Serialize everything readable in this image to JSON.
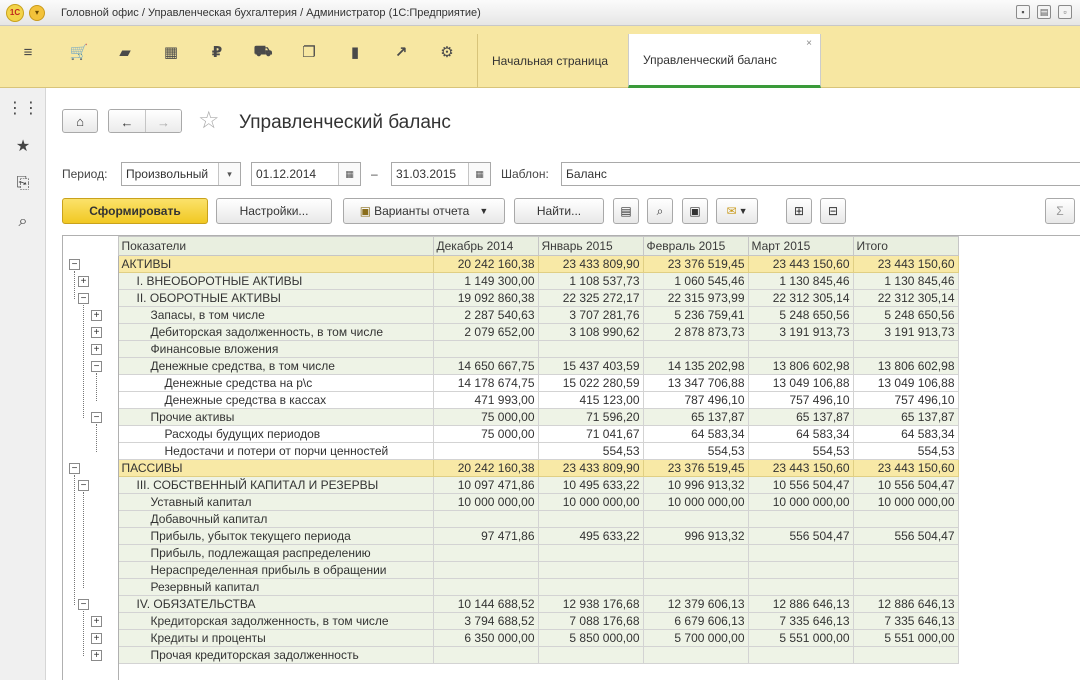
{
  "window": {
    "title": "Головной офис / Управленческая бухгалтерия / Администратор  (1С:Предприятие)",
    "logo_text": "1С"
  },
  "tabs": [
    {
      "label": "Начальная страница",
      "active": false
    },
    {
      "label": "Управленческий баланс",
      "active": true,
      "close": "×"
    }
  ],
  "section_icons": [
    "menu-icon",
    "cart-icon",
    "bag-icon",
    "grid-icon",
    "ruble-icon",
    "truck-icon",
    "documents-icon",
    "bar-chart-icon",
    "trend-icon",
    "gear-icon"
  ],
  "left_icons": [
    "apps-icon",
    "star-icon",
    "history-icon",
    "search-icon"
  ],
  "page": {
    "title": "Управленческий баланс"
  },
  "filters": {
    "period_label": "Период:",
    "period_type": "Произвольный",
    "date_from": "01.12.2014",
    "dash": "–",
    "date_to": "31.03.2015",
    "template_label": "Шаблон:",
    "template_value": "Баланс"
  },
  "commands": {
    "generate": "Сформировать",
    "settings": "Настройки...",
    "variants": "Варианты отчета",
    "find": "Найти...",
    "sum": "Σ"
  },
  "table": {
    "columns": [
      "Показатели",
      "Декабрь 2014",
      "Январь 2015",
      "Февраль 2015",
      "Март 2015",
      "Итого"
    ],
    "rows": [
      {
        "level": 0,
        "toggle": "−",
        "label": "АКТИВЫ",
        "values": [
          "20 242 160,38",
          "23 433 809,90",
          "23 376 519,45",
          "23 443 150,60",
          "23 443 150,60"
        ]
      },
      {
        "level": 1,
        "toggle": "+",
        "label": "I. ВНЕОБОРОТНЫЕ АКТИВЫ",
        "values": [
          "1 149 300,00",
          "1 108 537,73",
          "1 060 545,46",
          "1 130 845,46",
          "1 130 845,46"
        ]
      },
      {
        "level": 1,
        "toggle": "−",
        "label": "II. ОБОРОТНЫЕ АКТИВЫ",
        "values": [
          "19 092 860,38",
          "22 325 272,17",
          "22 315 973,99",
          "22 312 305,14",
          "22 312 305,14"
        ]
      },
      {
        "level": 2,
        "toggle": "+",
        "label": "Запасы, в том числе",
        "values": [
          "2 287 540,63",
          "3 707 281,76",
          "5 236 759,41",
          "5 248 650,56",
          "5 248 650,56"
        ]
      },
      {
        "level": 2,
        "toggle": "+",
        "label": "Дебиторская задолженность, в том числе",
        "values": [
          "2 079 652,00",
          "3 108 990,62",
          "2 878 873,73",
          "3 191 913,73",
          "3 191 913,73"
        ]
      },
      {
        "level": 2,
        "toggle": "+",
        "label": "Финансовые вложения",
        "values": [
          "",
          "",
          "",
          "",
          ""
        ]
      },
      {
        "level": 2,
        "toggle": "−",
        "label": "Денежные средства, в том числе",
        "values": [
          "14 650 667,75",
          "15 437 403,59",
          "14 135 202,98",
          "13 806 602,98",
          "13 806 602,98"
        ]
      },
      {
        "level": 3,
        "toggle": "",
        "label": "Денежные средства на р\\с",
        "values": [
          "14 178 674,75",
          "15 022 280,59",
          "13 347 706,88",
          "13 049 106,88",
          "13 049 106,88"
        ]
      },
      {
        "level": 3,
        "toggle": "",
        "label": "Денежные средства в кассах",
        "values": [
          "471 993,00",
          "415 123,00",
          "787 496,10",
          "757 496,10",
          "757 496,10"
        ]
      },
      {
        "level": 2,
        "toggle": "−",
        "label": "Прочие активы",
        "values": [
          "75 000,00",
          "71 596,20",
          "65 137,87",
          "65 137,87",
          "65 137,87"
        ]
      },
      {
        "level": 3,
        "toggle": "",
        "label": "Расходы будущих периодов",
        "values": [
          "75 000,00",
          "71 041,67",
          "64 583,34",
          "64 583,34",
          "64 583,34"
        ]
      },
      {
        "level": 3,
        "toggle": "",
        "label": "Недостачи и потери от порчи ценностей",
        "values": [
          "",
          "554,53",
          "554,53",
          "554,53",
          "554,53"
        ]
      },
      {
        "level": 0,
        "toggle": "−",
        "label": "ПАССИВЫ",
        "values": [
          "20 242 160,38",
          "23 433 809,90",
          "23 376 519,45",
          "23 443 150,60",
          "23 443 150,60"
        ]
      },
      {
        "level": 1,
        "toggle": "−",
        "label": "III. СОБСТВЕННЫЙ КАПИТАЛ И РЕЗЕРВЫ",
        "values": [
          "10 097 471,86",
          "10 495 633,22",
          "10 996 913,32",
          "10 556 504,47",
          "10 556 504,47"
        ]
      },
      {
        "level": 2,
        "toggle": "",
        "label": "Уставный капитал",
        "values": [
          "10 000 000,00",
          "10 000 000,00",
          "10 000 000,00",
          "10 000 000,00",
          "10 000 000,00"
        ]
      },
      {
        "level": 2,
        "toggle": "",
        "label": "Добавочный капитал",
        "values": [
          "",
          "",
          "",
          "",
          ""
        ]
      },
      {
        "level": 2,
        "toggle": "",
        "label": "Прибыль, убыток текущего периода",
        "values": [
          "97 471,86",
          "495 633,22",
          "996 913,32",
          "556 504,47",
          "556 504,47"
        ]
      },
      {
        "level": 2,
        "toggle": "",
        "label": "Прибыль, подлежащая распределению",
        "values": [
          "",
          "",
          "",
          "",
          ""
        ]
      },
      {
        "level": 2,
        "toggle": "",
        "label": "Нераспределенная прибыль в обращении",
        "values": [
          "",
          "",
          "",
          "",
          ""
        ]
      },
      {
        "level": 2,
        "toggle": "",
        "label": "Резервный капитал",
        "values": [
          "",
          "",
          "",
          "",
          ""
        ]
      },
      {
        "level": 1,
        "toggle": "−",
        "label": "IV. ОБЯЗАТЕЛЬСТВА",
        "values": [
          "10 144 688,52",
          "12 938 176,68",
          "12 379 606,13",
          "12 886 646,13",
          "12 886 646,13"
        ]
      },
      {
        "level": 2,
        "toggle": "+",
        "label": "Кредиторская задолженность, в том числе",
        "values": [
          "3 794 688,52",
          "7 088 176,68",
          "6 679 606,13",
          "7 335 646,13",
          "7 335 646,13"
        ]
      },
      {
        "level": 2,
        "toggle": "+",
        "label": "Кредиты и проценты",
        "values": [
          "6 350 000,00",
          "5 850 000,00",
          "5 700 000,00",
          "5 551 000,00",
          "5 551 000,00"
        ]
      },
      {
        "level": 2,
        "toggle": "+",
        "label": "Прочая кредиторская задолженность",
        "values": [
          "",
          "",
          "",
          "",
          ""
        ]
      }
    ]
  }
}
